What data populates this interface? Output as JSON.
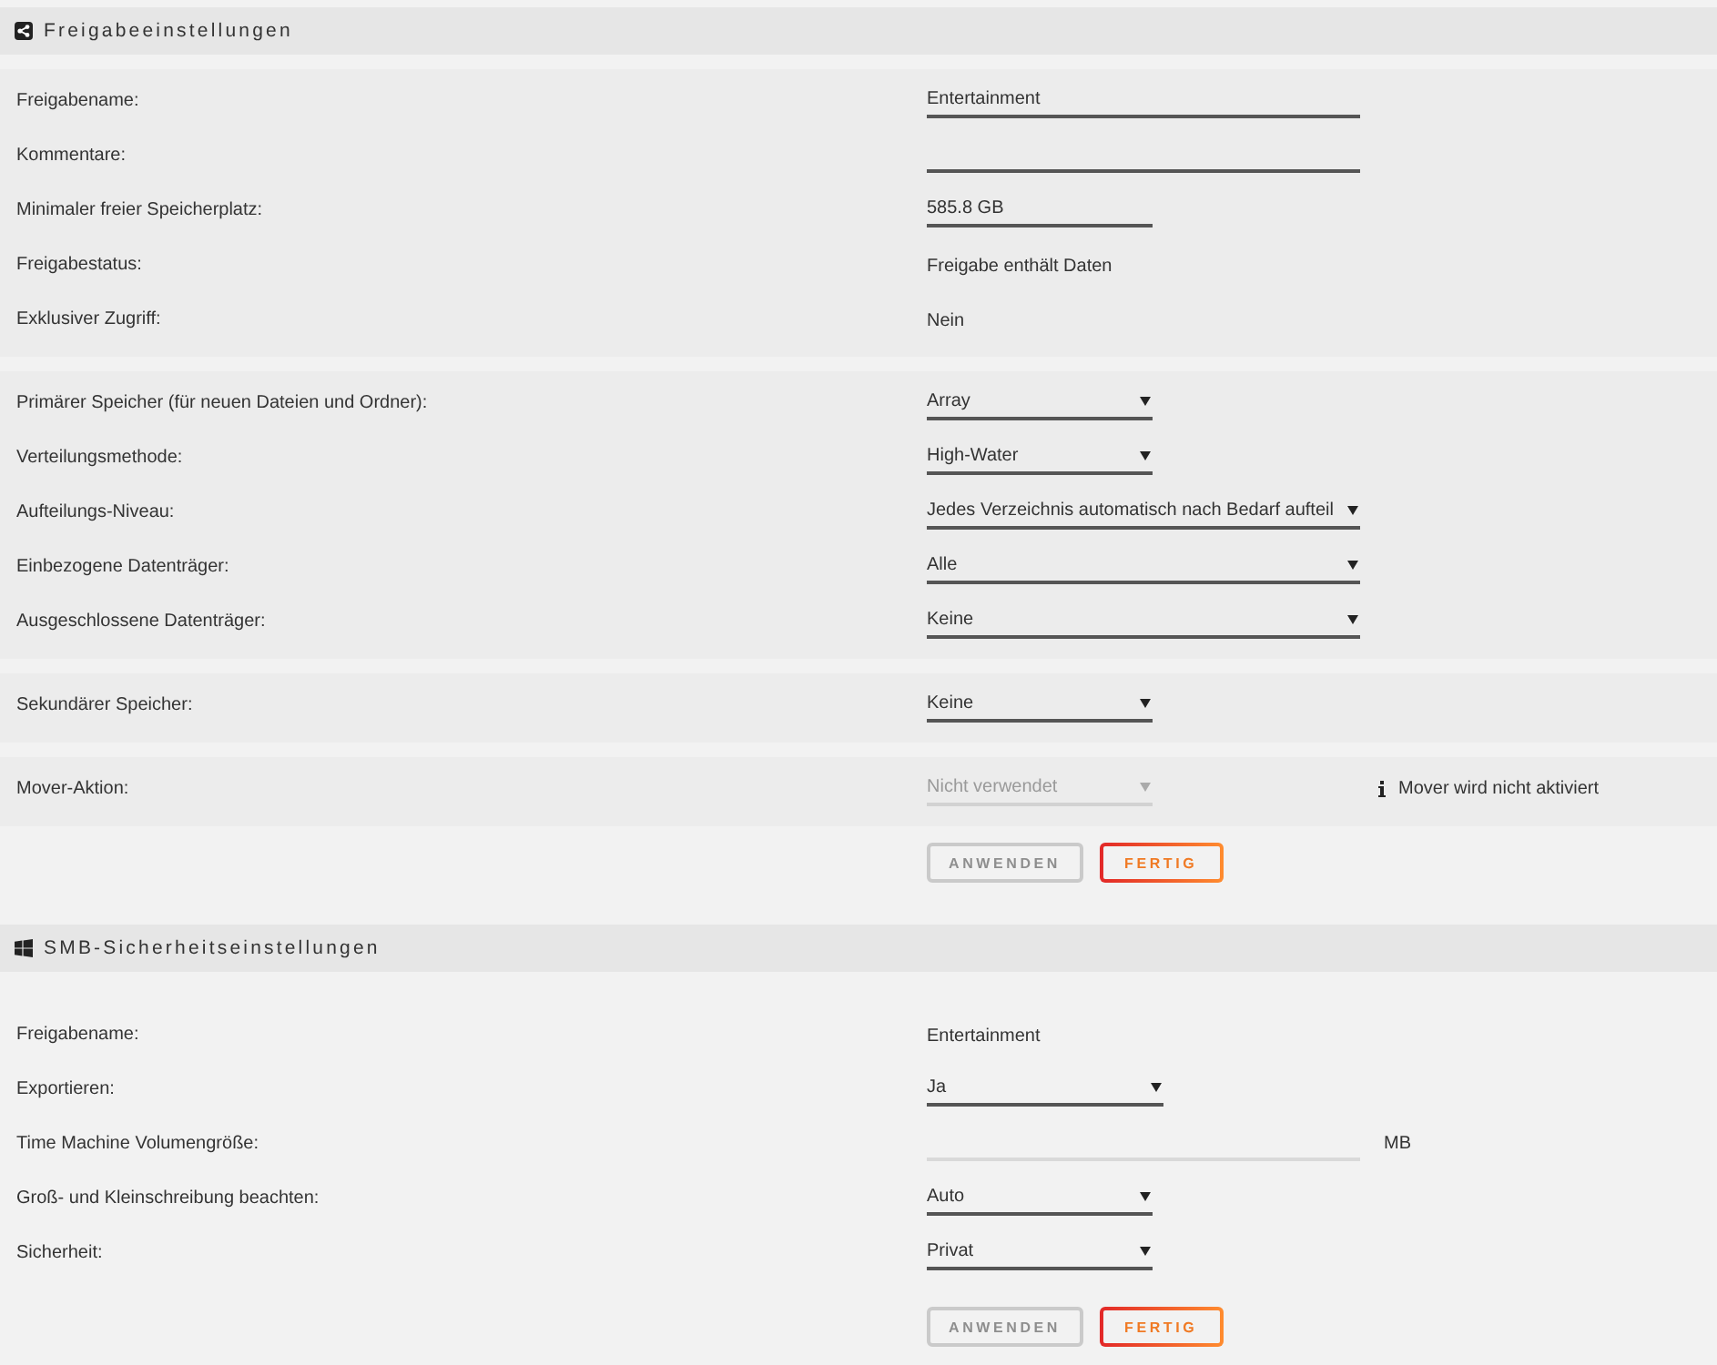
{
  "sections": [
    {
      "kind": "share",
      "title": "Freigabeeinstellungen",
      "groups": [
        {
          "rows": [
            {
              "label": "Freigabename:",
              "control": {
                "kind": "input",
                "value": "Entertainment",
                "disabled": false
              }
            },
            {
              "label": "Kommentare:",
              "control": {
                "kind": "input",
                "disabled": false
              }
            },
            {
              "label": "Minimaler freier Speicherplatz:",
              "control": {
                "kind": "input",
                "value": "585.8 GB",
                "disabled": false
              }
            },
            {
              "label": "Freigabestatus:",
              "control": {
                "kind": "text",
                "value": "Freigabe enthält Daten"
              }
            },
            {
              "label": "Exklusiver Zugriff:",
              "control": {
                "kind": "text",
                "value": "Nein"
              }
            }
          ]
        },
        {
          "rows": [
            {
              "label": "Primärer Speicher (für neuen Dateien und Ordner):",
              "control": {
                "kind": "select",
                "value": "Array",
                "disabled": false
              }
            },
            {
              "label": "Verteilungsmethode:",
              "control": {
                "kind": "select",
                "value": "High-Water",
                "disabled": false
              }
            },
            {
              "label": "Aufteilungs-Niveau:",
              "control": {
                "kind": "select",
                "value": "Jedes Verzeichnis automatisch nach Bedarf aufteil",
                "disabled": false
              }
            },
            {
              "label": "Einbezogene Datenträger:",
              "control": {
                "kind": "select",
                "value": "Alle",
                "disabled": false
              }
            },
            {
              "label": "Ausgeschlossene Datenträger:",
              "control": {
                "kind": "select",
                "value": "Keine",
                "disabled": false
              }
            }
          ]
        },
        {
          "rows": [
            {
              "label": "Sekundärer Speicher:",
              "control": {
                "kind": "select",
                "value": "Keine",
                "disabled": false
              }
            }
          ]
        },
        {
          "rows": [
            {
              "label": "Mover-Aktion:",
              "control": {
                "kind": "select",
                "value": "Nicht verwendet",
                "disabled": true
              },
              "note": "Mover wird nicht aktiviert"
            }
          ]
        }
      ],
      "buttons": [
        {
          "label": "ANWENDEN",
          "disabled": true
        },
        {
          "label": "FERTIG",
          "disabled": false
        }
      ]
    },
    {
      "kind": "smb",
      "title": "SMB-Sicherheitseinstellungen",
      "groups": [
        {
          "rows": [
            {
              "label": "Freigabename:",
              "control": {
                "kind": "text",
                "value": "Entertainment"
              }
            },
            {
              "label": "Exportieren:",
              "control": {
                "kind": "select",
                "value": "Ja",
                "disabled": false
              }
            },
            {
              "label": "Time Machine Volumengröße:",
              "control": {
                "kind": "input",
                "disabled": true
              },
              "suffix": "MB"
            },
            {
              "label": "Groß- und Kleinschreibung beachten:",
              "control": {
                "kind": "select",
                "value": "Auto",
                "disabled": false
              }
            },
            {
              "label": "Sicherheit:",
              "control": {
                "kind": "select",
                "value": "Privat",
                "disabled": false
              }
            }
          ]
        }
      ],
      "buttons": [
        {
          "label": "ANWENDEN",
          "disabled": true
        },
        {
          "label": "FERTIG",
          "disabled": false
        }
      ]
    }
  ]
}
